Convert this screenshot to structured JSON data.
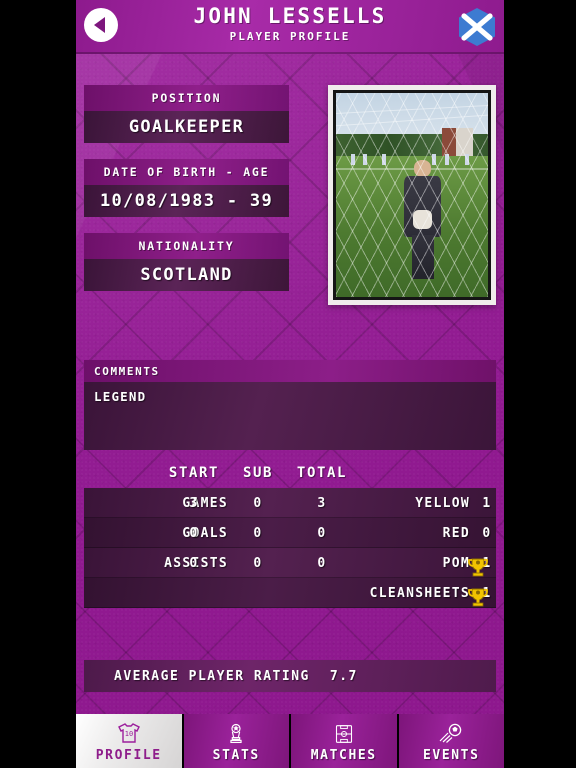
{
  "header": {
    "title": "JOHN LESSELLS",
    "subtitle": "PLAYER PROFILE",
    "back_icon": "back-arrow-icon",
    "flag_icon": "scotland-flag-hex-icon",
    "flag_colors": {
      "field": "#3d7bd1",
      "cross": "#ffffff"
    }
  },
  "profile": {
    "fields": [
      {
        "label": "POSITION",
        "value": "GOALKEEPER"
      },
      {
        "label": "DATE OF BIRTH - AGE",
        "value": "10/08/1983 - 39"
      },
      {
        "label": "NATIONALITY",
        "value": "SCOTLAND"
      }
    ],
    "photo_alt": "player-photo"
  },
  "comments": {
    "heading": "COMMENTS",
    "text": "LEGEND"
  },
  "stats": {
    "columns": [
      "START",
      "SUB",
      "TOTAL"
    ],
    "rows": [
      {
        "label": "GAMES",
        "start": "3",
        "sub": "0",
        "total": "3",
        "right_label": "YELLOW",
        "right_value": "1",
        "trophy": false
      },
      {
        "label": "GOALS",
        "start": "0",
        "sub": "0",
        "total": "0",
        "right_label": "RED",
        "right_value": "0",
        "trophy": false
      },
      {
        "label": "ASSISTS",
        "start": "0",
        "sub": "0",
        "total": "0",
        "right_label": "POM",
        "right_value": "1",
        "trophy": true
      },
      {
        "label": "",
        "start": "",
        "sub": "",
        "total": "",
        "right_label": "CLEANSHEETS",
        "right_value": "1",
        "trophy": true
      }
    ]
  },
  "rating": {
    "label": "AVERAGE PLAYER RATING",
    "value": "7.7"
  },
  "nav": {
    "items": [
      {
        "label": "PROFILE",
        "icon": "jersey-icon",
        "active": true
      },
      {
        "label": "STATS",
        "icon": "trophy-icon",
        "active": false
      },
      {
        "label": "MATCHES",
        "icon": "pitch-icon",
        "active": false
      },
      {
        "label": "EVENTS",
        "icon": "soccer-ball-icon",
        "active": false
      }
    ]
  },
  "theme": {
    "purple": "#9c1f9c",
    "dark_purple": "#3a1438",
    "gold": "#f2c300",
    "flag_blue": "#3d7bd1"
  }
}
